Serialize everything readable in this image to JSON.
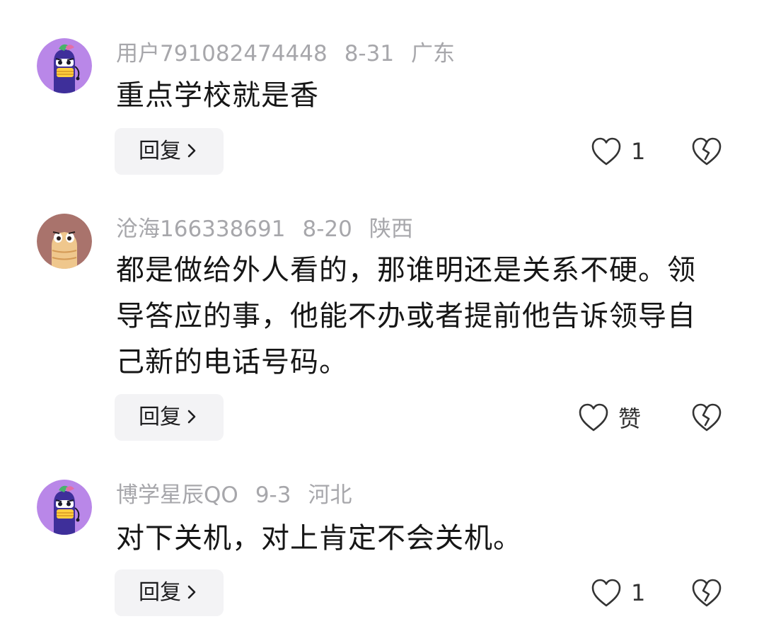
{
  "comments": [
    {
      "username": "用户791082474448",
      "date": "8-31",
      "location": "广东",
      "text": "重点学校就是香",
      "reply_label": "回复",
      "like_label": "1",
      "avatar_icon": "purple-eggplant-mascot-avatar"
    },
    {
      "username": "沧海166338691",
      "date": "8-20",
      "location": "陕西",
      "text": "都是做给外人看的，那谁明还是关系不硬。领导答应的事，他能不办或者提前他告诉领导自己新的电话号码。",
      "reply_label": "回复",
      "like_label": "赞",
      "avatar_icon": "brown-bread-mascot-avatar"
    },
    {
      "username": "博学星辰QO",
      "date": "9-3",
      "location": "河北",
      "text": "对下关机，对上肯定不会关机。",
      "reply_label": "回复",
      "like_label": "1",
      "avatar_icon": "purple-eggplant-mascot-avatar"
    }
  ],
  "icons": {
    "like": "heart-outline-icon",
    "dislike": "broken-heart-icon",
    "reply_arrow": "chevron-right-icon"
  },
  "colors": {
    "meta_text": "#a7a7ab",
    "body_text": "#161616",
    "reply_bg": "#f3f3f5",
    "avatar_purple": "#b987e8",
    "avatar_brown": "#a9736c"
  }
}
